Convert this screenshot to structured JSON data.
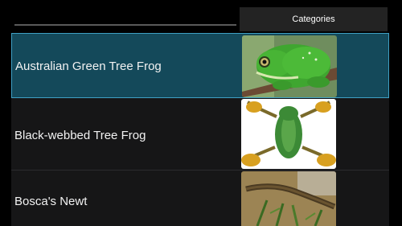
{
  "header": {
    "search": {
      "value": "",
      "placeholder": ""
    },
    "categories_label": "Categories"
  },
  "list": {
    "items": [
      {
        "label": "Australian Green Tree Frog",
        "icon": "green-tree-frog-photo",
        "selected": true
      },
      {
        "label": "Black-webbed Tree Frog",
        "icon": "black-webbed-tree-frog-photo",
        "selected": false
      },
      {
        "label": "Bosca's Newt",
        "icon": "boscas-newt-photo",
        "selected": false
      }
    ]
  },
  "colors": {
    "background": "#000000",
    "row_background": "#161617",
    "selected_row_background": "#14495a",
    "selected_row_border": "#3fa0c4",
    "button_background": "#232323",
    "text": "#f2f2f2"
  }
}
